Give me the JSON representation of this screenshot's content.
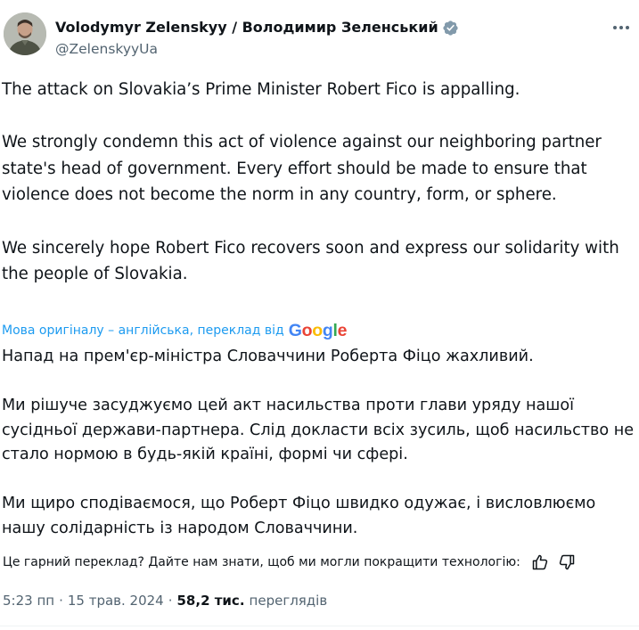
{
  "author": {
    "name": "Volodymyr Zelenskyy / Володимир Зеленський",
    "handle": "@ZelenskyyUa",
    "verified": true,
    "avatar_icon": "profile-photo"
  },
  "tweet": {
    "paragraphs": [
      "The attack on Slovakia’s Prime Minister Robert Fico is appalling.",
      "We strongly condemn this act of violence against our neighboring partner state's head of government. Every effort should be made to ensure that violence does not become the norm in any country, form, or sphere.",
      "We sincerely hope Robert Fico recovers soon and express our solidarity with the people of Slovakia."
    ]
  },
  "translation": {
    "note": "Мова оригіналу – англійська, переклад від",
    "provider": "Google",
    "paragraphs": [
      "Напад на прем'єр-міністра Словаччини Роберта Фіцо жахливий.",
      "Ми рішуче засуджуємо цей акт насильства проти глави уряду нашої сусідньої держави-партнера. Слід докласти всіх зусиль, щоб насильство не стало нормою в будь-якій країні, формі чи сфері.",
      "Ми щиро сподіваємося, що Роберт Фіцо швидко одужає, і висловлюємо нашу солідарність із народом Словаччини."
    ],
    "feedback_question": "Це гарний переклад? Дайте нам знати, щоб ми могли покращити технологію:"
  },
  "meta": {
    "time": "5:23 пп",
    "separator": "·",
    "date": "15 трав. 2024",
    "views_count": "58,2 тис.",
    "views_label": "переглядів"
  },
  "colors": {
    "accent": "#1d9bf0",
    "text": "#0f1419",
    "secondary": "#536471",
    "verified_badge": "#829aab"
  },
  "icons": {
    "verified": "verified-badge-icon",
    "more": "more-options-icon",
    "thumbs_up": "thumbs-up-icon",
    "thumbs_down": "thumbs-down-icon"
  }
}
